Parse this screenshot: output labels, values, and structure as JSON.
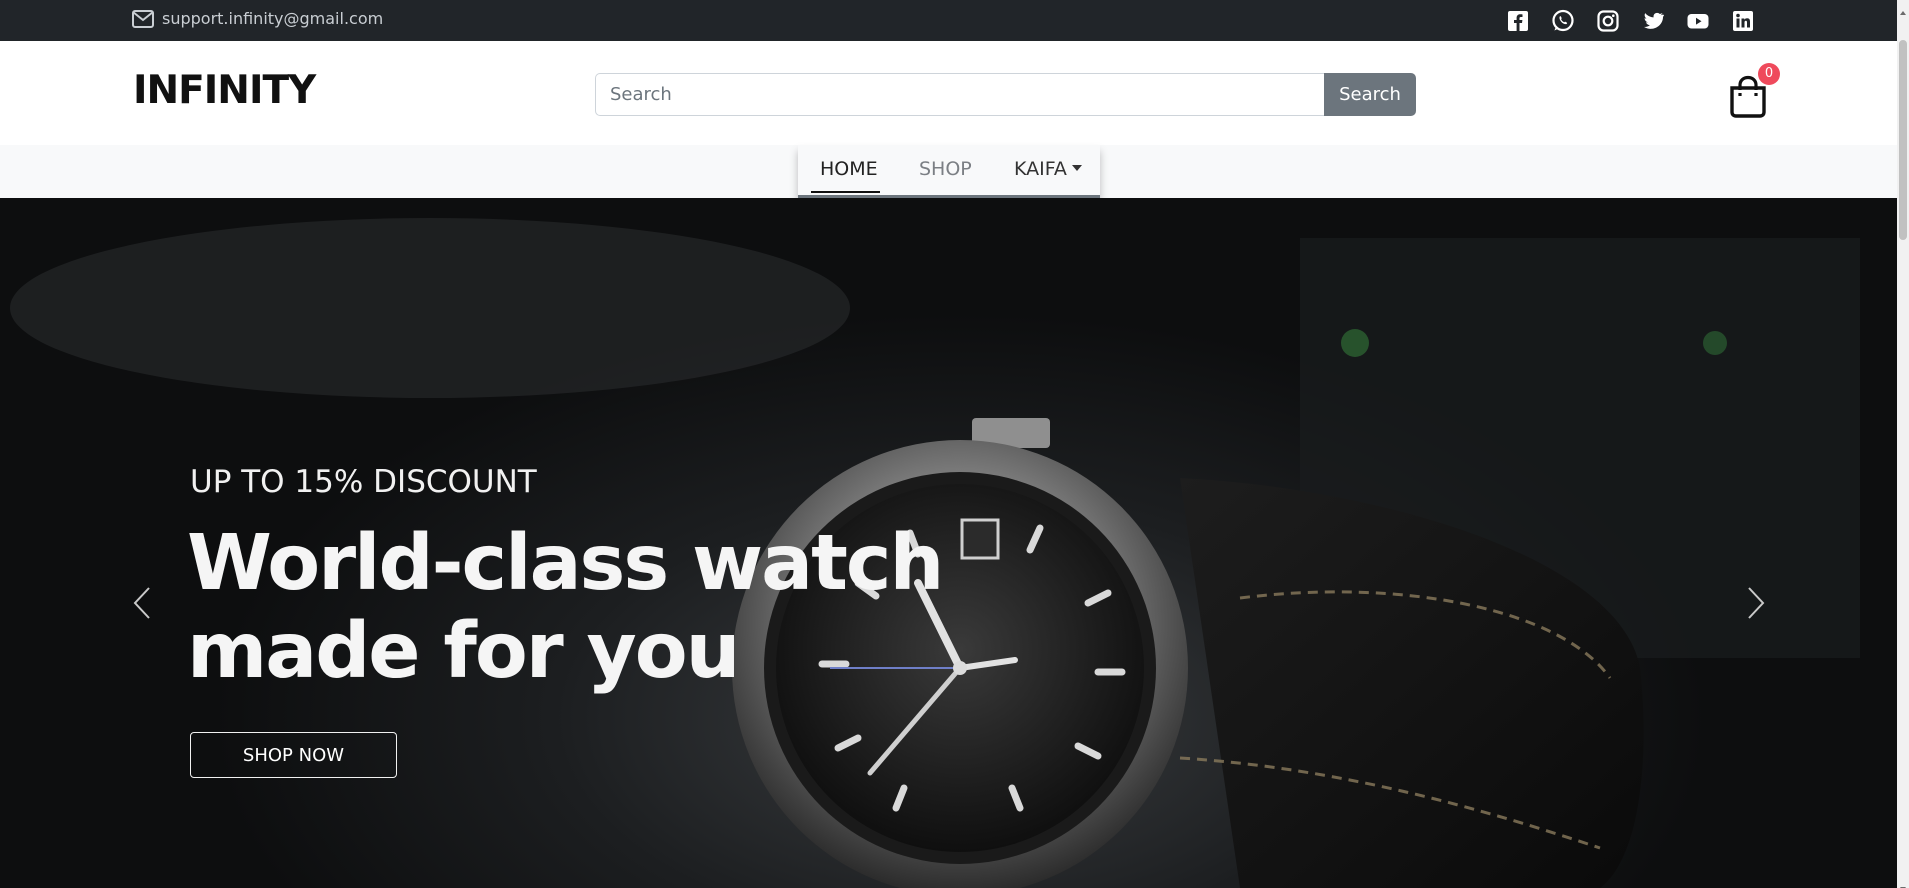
{
  "topbar": {
    "email": "support.infinity@gmail.com",
    "icons": [
      "mail-icon",
      "facebook-icon",
      "whatsapp-icon",
      "instagram-icon",
      "twitter-icon",
      "youtube-icon",
      "linkedin-icon"
    ]
  },
  "header": {
    "logo": "INFINITY",
    "search_placeholder": "Search",
    "search_button": "Search",
    "cart_count": "0"
  },
  "nav": {
    "items": [
      {
        "label": "HOME",
        "active": true
      },
      {
        "label": "SHOP",
        "active": false
      },
      {
        "label": "KAIFA",
        "active": false
      }
    ]
  },
  "hero": {
    "subtitle": "UP TO 15% DISCOUNT",
    "title_line1": "World-class watch",
    "title_line2": "made for you",
    "cta": "SHOP NOW"
  },
  "colors": {
    "topbar_bg": "#212529",
    "search_button_bg": "#6c757d",
    "badge_bg": "#ef4a5c",
    "nav_bg": "#f8f9fa"
  }
}
